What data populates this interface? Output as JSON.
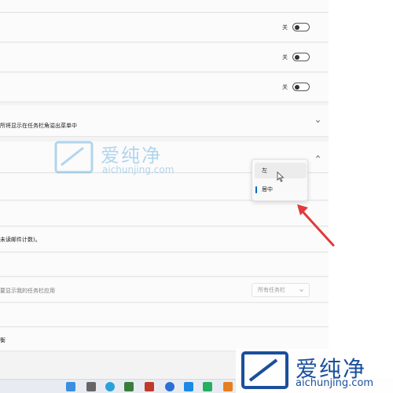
{
  "toggles": [
    {
      "state_label": "关",
      "on": false
    },
    {
      "state_label": "关",
      "on": false
    },
    {
      "state_label": "关",
      "on": false
    }
  ],
  "rows": {
    "overflow_desc": "所将显示在任务栏角溢出菜单中",
    "unread_desc": "未读邮件计数)。",
    "multi_monitor_desc": "要显示我的任务栏应用",
    "last_row_text": "衡"
  },
  "taskbar_alignment_menu": {
    "options": [
      {
        "label": "左",
        "hovered": true,
        "selected": false
      },
      {
        "label": "居中",
        "hovered": false,
        "selected": true
      }
    ]
  },
  "multi_monitor_select": {
    "value": "所有任务栏"
  },
  "watermark": {
    "text_cn": "爱纯净",
    "text_en": "aichunjing.com"
  },
  "corner_logo": {
    "text_cn": "爱纯净",
    "text_en": "aichunjing.com"
  },
  "colors": {
    "accent": "#0067c0",
    "arrow": "#e03a3a",
    "watermark": "#2a8fd6"
  },
  "taskbar": {
    "icons": [
      "windows-start-icon",
      "task-view-icon",
      "edge-icon",
      "app-icon",
      "tool-icon",
      "app-icon",
      "edge-icon",
      "app-icon",
      "wechat-icon",
      "app-icon"
    ]
  }
}
